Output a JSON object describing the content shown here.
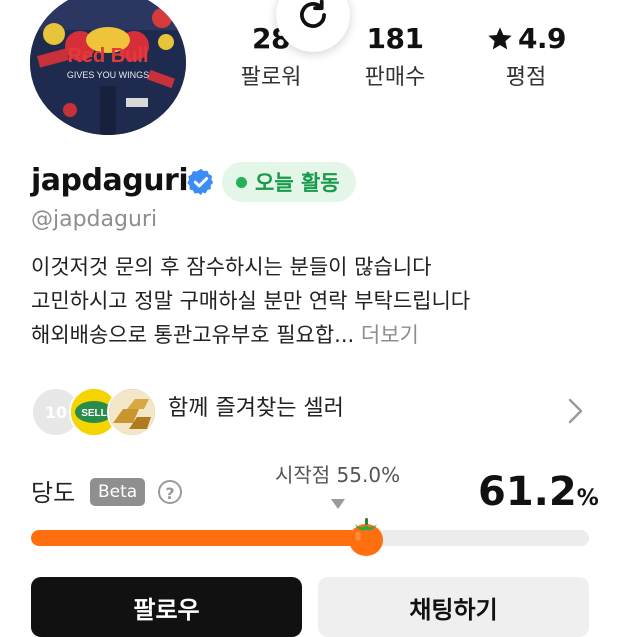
{
  "profile": {
    "avatar_icon": "red-bull-jacket-photo",
    "avatar_text": {
      "brand": "Red Bull",
      "slogan": "GIVES YOU WINGS"
    },
    "username": "japdaguri",
    "handle": "@japdaguri",
    "activity_badge": "오늘 활동",
    "verified_icon": "verified-check-icon"
  },
  "stats": {
    "followers": {
      "value": "28",
      "label": "팔로워"
    },
    "sales": {
      "value": "181",
      "label": "판매수"
    },
    "rating": {
      "value": "4.9",
      "label": "평점",
      "icon": "star-icon"
    }
  },
  "refresh_icon": "refresh-icon",
  "bio": {
    "lines": [
      "이것저것 문의 후 잠수하시는 분들이 많습니다",
      "고민하시고 정말 구매하실 분만 연락 부탁드립니다",
      "해외배송으로 통관고유부호 필요합..."
    ],
    "more_label": "더보기"
  },
  "favorite_sellers": {
    "label": "함께 즐겨찾는 셀러",
    "avatars": [
      {
        "text": "10"
      },
      {
        "text": "SELL"
      },
      {
        "text": ""
      }
    ]
  },
  "sweetness": {
    "label": "당도",
    "beta_label": "Beta",
    "help_icon_text": "?",
    "start_text": "시작점 55.0%",
    "start_value": 55.0,
    "value_number": "61.2",
    "value_unit": "%",
    "value": 61.2
  },
  "actions": {
    "follow_label": "팔로우",
    "chat_label": "채팅하기"
  },
  "colors": {
    "accent_orange": "#ff6f0f",
    "active_green": "#22b35a",
    "verified_blue": "#3b8cf5"
  }
}
